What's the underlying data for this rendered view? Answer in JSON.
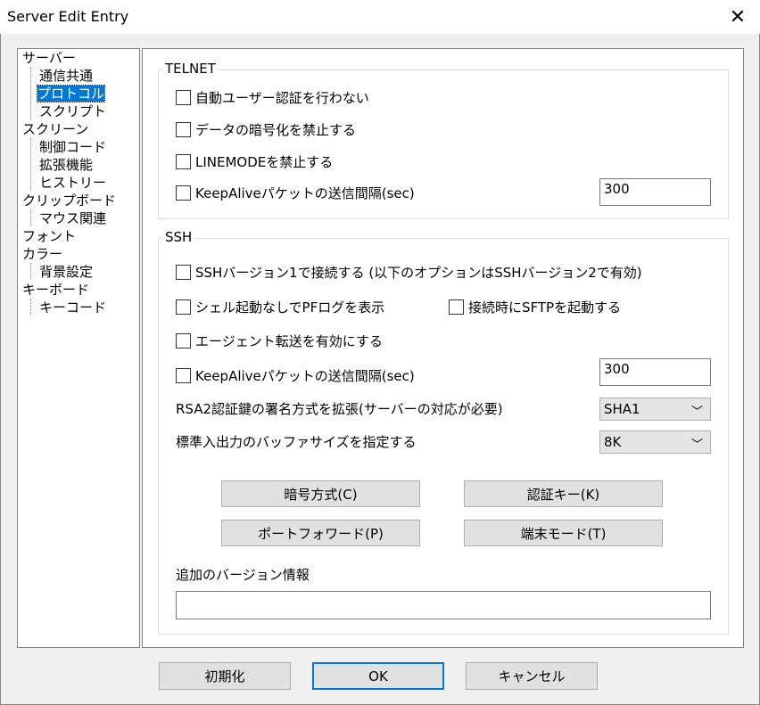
{
  "window": {
    "title": "Server Edit Entry"
  },
  "tree": {
    "items": [
      {
        "label": "サーバー",
        "indent": 0
      },
      {
        "label": "通信共通",
        "indent": 1
      },
      {
        "label": "プロトコル",
        "indent": 1,
        "selected": true
      },
      {
        "label": "スクリプト",
        "indent": 1
      },
      {
        "label": "スクリーン",
        "indent": 0
      },
      {
        "label": "制御コード",
        "indent": 1
      },
      {
        "label": "拡張機能",
        "indent": 1
      },
      {
        "label": "ヒストリー",
        "indent": 1
      },
      {
        "label": "クリップボード",
        "indent": 0
      },
      {
        "label": "マウス関連",
        "indent": 1
      },
      {
        "label": "フォント",
        "indent": 0
      },
      {
        "label": "カラー",
        "indent": 0
      },
      {
        "label": "背景設定",
        "indent": 1
      },
      {
        "label": "キーボード",
        "indent": 0
      },
      {
        "label": "キーコード",
        "indent": 1
      }
    ]
  },
  "telnet": {
    "group_label": "TELNET",
    "auto_login": "自動ユーザー認証を行わない",
    "no_encrypt": "データの暗号化を禁止する",
    "no_linemode": "LINEMODEを禁止する",
    "keepalive": "KeepAliveパケットの送信間隔(sec)",
    "keepalive_value": "300"
  },
  "ssh": {
    "group_label": "SSH",
    "ssh1": "SSHバージョン1で接続する (以下のオプションはSSHバージョン2で有効)",
    "pf_log": "シェル起動なしでPFログを表示",
    "sftp": "接続時にSFTPを起動する",
    "agent": "エージェント転送を有効にする",
    "keepalive": "KeepAliveパケットの送信間隔(sec)",
    "keepalive_value": "300",
    "rsa_label": "RSA2認証鍵の署名方式を拡張(サーバーの対応が必要)",
    "rsa_value": "SHA1",
    "buffer_label": "標準入出力のバッファサイズを指定する",
    "buffer_value": "8K",
    "cipher_button": "暗号方式(C)",
    "auth_key_button": "認証キー(K)",
    "port_forward_button": "ポートフォワード(P)",
    "terminal_mode_button": "端末モード(T)",
    "version_label": "追加のバージョン情報",
    "version_value": ""
  },
  "footer": {
    "init_button": "初期化",
    "ok_button": "OK",
    "cancel_button": "キャンセル"
  }
}
